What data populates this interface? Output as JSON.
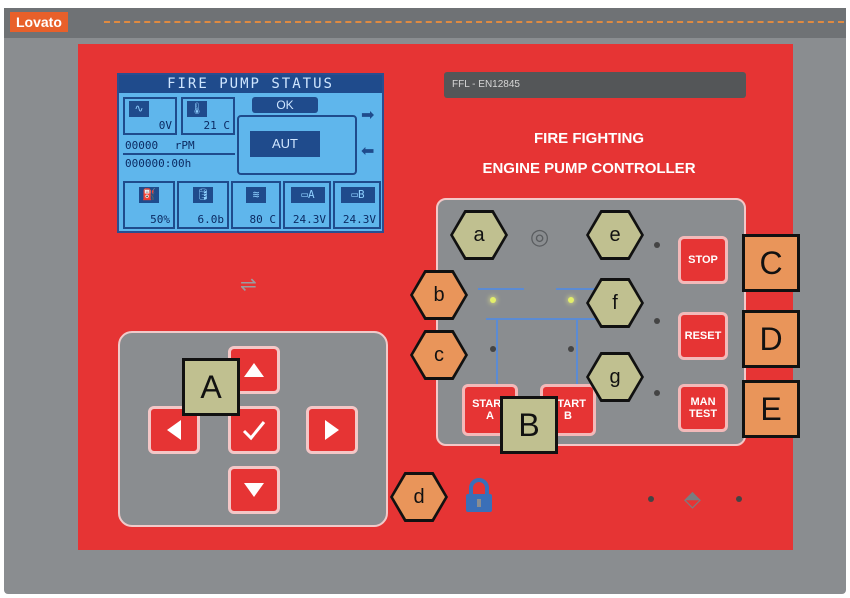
{
  "brand": {
    "logo": "Lovato"
  },
  "lcd": {
    "title": "FIRE PUMP STATUS",
    "status_ok": "OK",
    "mode": "AUT",
    "voltage": "0V",
    "temperature": "21 C",
    "rpm_value": "00000",
    "rpm_unit": "rPM",
    "hours": "000000:00h",
    "fuel_level": "50%",
    "oil_pressure": "6.0b",
    "coolant_temp": "80 C",
    "battery_a": "24.3V",
    "battery_b": "24.3V",
    "battery_a_label": "A",
    "battery_b_label": "B"
  },
  "model_label": "FFL - EN12845",
  "headings": {
    "line1": "FIRE FIGHTING",
    "line2": "ENGINE PUMP CONTROLLER"
  },
  "buttons": {
    "stop": "STOP",
    "reset": "RESET",
    "man_test_1": "MAN",
    "man_test_2": "TEST",
    "start_a_1": "START",
    "start_a_2": "A",
    "start_b_1": "START",
    "start_b_2": "B"
  },
  "callouts": {
    "a": "a",
    "b": "b",
    "c": "c",
    "d": "d",
    "e": "e",
    "f": "f",
    "g": "g",
    "A": "A",
    "B": "B",
    "C": "C",
    "D": "D",
    "E": "E"
  },
  "colors": {
    "panel_red": "#e63434",
    "callout_olive": "#c0c090",
    "callout_orange": "#e9955a",
    "lcd_blue": "#5fb6ec"
  },
  "icons": [
    "sine-wave-icon",
    "thermometer-icon",
    "fuel-icon",
    "oil-icon",
    "coolant-icon",
    "battery-icon",
    "lock-icon",
    "arrow-up-icon",
    "arrow-down-icon",
    "arrow-left-icon",
    "arrow-right-icon",
    "check-icon"
  ]
}
